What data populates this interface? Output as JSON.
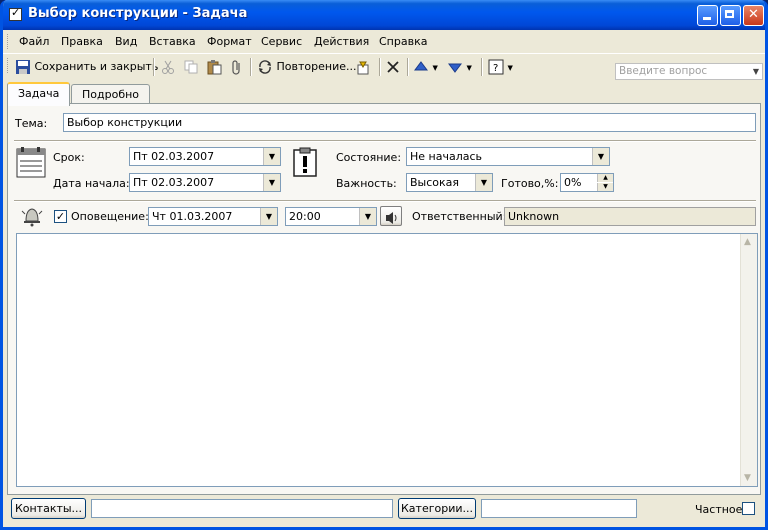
{
  "window": {
    "title": "Выбор конструкции - Задача"
  },
  "menu": {
    "items": [
      "Файл",
      "Правка",
      "Вид",
      "Вставка",
      "Формат",
      "Сервис",
      "Действия",
      "Справка"
    ],
    "ask_placeholder": "Введите вопрос"
  },
  "toolbar": {
    "save_close": "Сохранить и закрыть",
    "recurrence": "Повторение..."
  },
  "tabs": [
    "Задача",
    "Подробно"
  ],
  "form": {
    "subject_label": "Тема:",
    "subject_value": "Выбор конструкции",
    "due_label": "Срок:",
    "due_value": "Пт 02.03.2007",
    "start_label": "Дата начала:",
    "start_value": "Пт 02.03.2007",
    "status_label": "Состояние:",
    "status_value": "Не началась",
    "priority_label": "Важность:",
    "priority_value": "Высокая",
    "complete_label": "Готово,%:",
    "complete_value": "0%",
    "reminder_label": "Оповещение:",
    "reminder_checked": true,
    "reminder_date": "Чт 01.03.2007",
    "reminder_time": "20:00",
    "owner_label": "Ответственный:",
    "owner_value": "Unknown"
  },
  "footer": {
    "contacts_button": "Контакты...",
    "categories_button": "Категории...",
    "private_label": "Частное"
  }
}
